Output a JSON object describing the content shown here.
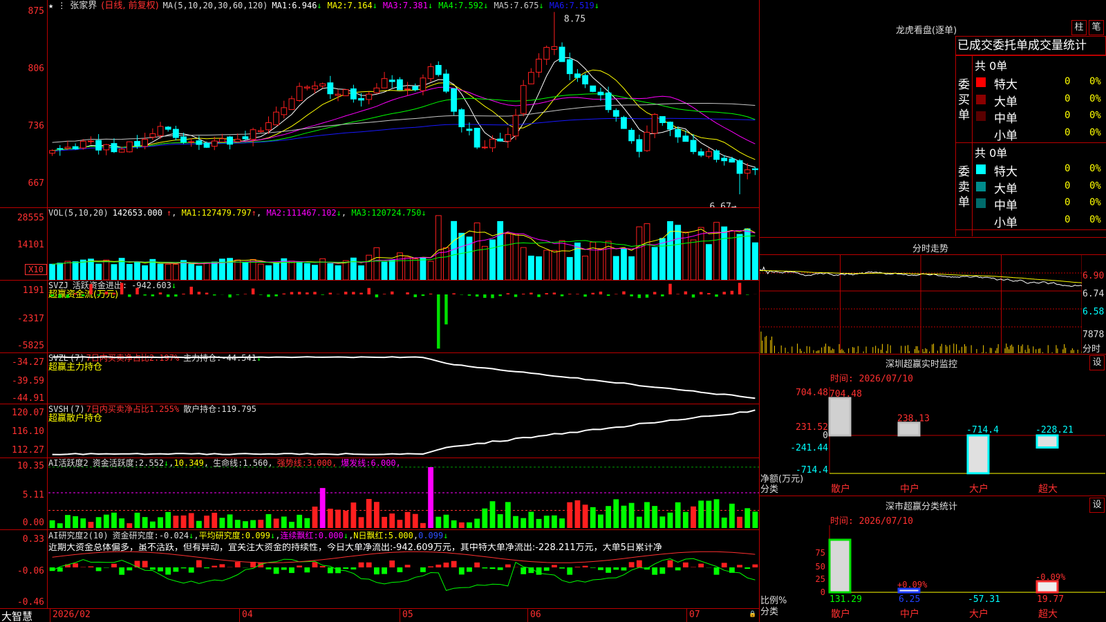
{
  "colors": {
    "up": "#ff1f1f",
    "down": "#00ffff",
    "bg": "#000000",
    "grid": "#bb0000",
    "axis": "#ff3030",
    "ma1": "#ffffff",
    "ma2": "#ffff00",
    "ma3": "#ff00ff",
    "ma4": "#00ff00",
    "ma5": "#c8c8c8",
    "ma6": "#1818ff"
  },
  "price": {
    "stock_name": "张家界",
    "period_label": "(日线, 前复权)",
    "ma_params": "MA(5,10,20,30,60,120)",
    "ma_values": [
      {
        "label": "MA1:",
        "value": "6.946",
        "arrow": "↓",
        "color": "#ffffff"
      },
      {
        "label": "MA2:",
        "value": "7.164",
        "arrow": "↓",
        "color": "#ffff00"
      },
      {
        "label": "MA3:",
        "value": "7.381",
        "arrow": "↓",
        "color": "#ff00ff"
      },
      {
        "label": "MA4:",
        "value": "7.592",
        "arrow": "↓",
        "color": "#00ff00"
      },
      {
        "label": "MA5:",
        "value": "7.675",
        "arrow": "↓",
        "color": "#c8c8c8"
      },
      {
        "label": "MA6:",
        "value": "7.519",
        "arrow": "↓",
        "color": "#1818ff"
      }
    ],
    "y_ticks": [
      "875",
      "806",
      "736",
      "667"
    ],
    "high_label": "8.75",
    "low_label": "6.67",
    "chart_data": {
      "type": "candlestick",
      "bars": 92,
      "ylim": [
        6.6,
        8.8
      ],
      "high": 8.75,
      "low": 6.67,
      "last_close": 6.95,
      "keypoints": [
        [
          0,
          7.2
        ],
        [
          5,
          7.25
        ],
        [
          10,
          7.2
        ],
        [
          14,
          7.25
        ],
        [
          18,
          7.45
        ],
        [
          22,
          7.25
        ],
        [
          27,
          7.25
        ],
        [
          32,
          7.35
        ],
        [
          38,
          7.6
        ],
        [
          42,
          7.95
        ],
        [
          47,
          7.85
        ],
        [
          52,
          7.75
        ],
        [
          55,
          7.95
        ],
        [
          60,
          7.85
        ],
        [
          63,
          8.2
        ],
        [
          66,
          7.65
        ],
        [
          70,
          7.25
        ],
        [
          75,
          7.3
        ],
        [
          79,
          8.1
        ],
        [
          82,
          8.45
        ],
        [
          86,
          8.0
        ],
        [
          90,
          7.85
        ],
        [
          93,
          7.55
        ],
        [
          97,
          7.2
        ],
        [
          100,
          7.6
        ],
        [
          105,
          7.2
        ],
        [
          110,
          7.05
        ],
        [
          116,
          6.9
        ]
      ],
      "seed": 11
    }
  },
  "vol": {
    "params": "VOL(5,10,20)",
    "value": "142653.000",
    "arrow": "↑",
    "mas": [
      {
        "label": "MA1:",
        "value": "127479.797",
        "arrow": "↑",
        "color": "#ffff00"
      },
      {
        "label": "MA2:",
        "value": "111467.102",
        "arrow": "↓",
        "color": "#ff00ff"
      },
      {
        "label": "MA3:",
        "value": "120724.750",
        "arrow": "↓",
        "color": "#00ff00"
      }
    ],
    "y_ticks": [
      "28555",
      "14101"
    ],
    "unit": "X10",
    "chart_data": {
      "type": "bar",
      "bars": 92,
      "ylim": [
        0,
        29000
      ],
      "seed": 23
    }
  },
  "svzj": {
    "name": "SVZJ",
    "label": "活跃资金进出:",
    "value": "-942.603",
    "arrow": "↓",
    "sub": "超赢资金流(万元)",
    "y_ticks": [
      "1191",
      "-2317",
      "-5825"
    ],
    "chart_data": {
      "type": "bar",
      "bars": 92,
      "ylim": [
        -6000,
        1500
      ],
      "seed": 31
    }
  },
  "svzl": {
    "name": "SVZL",
    "param": "(7)",
    "ratio": "7日内买卖净占比2.197%",
    "label": "主力持仓:",
    "value": "-44.541",
    "arrow": "↓",
    "sub": "超赢主力持仓",
    "y_ticks": [
      "-34.27",
      "-39.59",
      "-44.91"
    ],
    "chart_data": {
      "type": "line",
      "bars": 92,
      "ylim": [
        -46,
        -33
      ],
      "start": -34.2,
      "end": -44.6
    }
  },
  "svsh": {
    "name": "SVSH",
    "param": "(7)",
    "ratio": "7日内买卖净占比1.255%",
    "label": "散户持仓:",
    "value": "119.795",
    "sub": "超赢散户持仓",
    "y_ticks": [
      "120.07",
      "116.10",
      "112.27"
    ],
    "chart_data": {
      "type": "line",
      "bars": 92,
      "ylim": [
        111.8,
        121
      ],
      "start": 112.4,
      "end": 119.8
    }
  },
  "aihy": {
    "name": "AI活跃度2",
    "l1": "资金活跃度:",
    "v1": "2.552",
    "a1": "↓",
    "v2": "10.349",
    "l3": "生命线:",
    "v3": "1.560",
    "l4": "强势线:",
    "v4": "3.000",
    "l5": "爆发线:",
    "v5": "6.000",
    "y_ticks": [
      "10.35",
      "5.11",
      "0.00"
    ],
    "chart_data": {
      "type": "bar",
      "bars": 92,
      "ylim": [
        0,
        11
      ],
      "seed": 47
    }
  },
  "aiyj": {
    "name": "AI研究度2(10)",
    "l1": "资金研究度:",
    "v1": "-0.024",
    "a1": "↓",
    "l2": "平均研究度:",
    "v2": "0.099",
    "a2": "↓",
    "l3": "连续飘红:",
    "v3": "0.000",
    "a3": "↓",
    "l4": "N日飘红:",
    "v4": "5.000",
    "v5": "0.099",
    "a5": "↓",
    "comment": "近期大资金总体偏多，虽不活跃，但有异动，宜关注大资金的持续性，今日大单净流出:-942.609万元，其中特大单净流出:-228.211万元，大单5日累计净",
    "y_ticks": [
      "0.33",
      "-0.06",
      "-0.46"
    ],
    "chart_data": {
      "type": "bar",
      "bars": 92,
      "ylim": [
        -0.5,
        0.35
      ],
      "seed": 59
    }
  },
  "xaxis": {
    "brand": "大智慧",
    "labels": [
      "2026/02",
      "04",
      "05",
      "06",
      "07"
    ]
  },
  "lhb": {
    "title": "龙虎看盘(逐单)",
    "btn1": "柱",
    "btn2": "笔",
    "tabs": [
      "已成交",
      "委托单",
      "成交量统计"
    ],
    "buy": {
      "group": "委买单",
      "total": "共 0单",
      "rows": [
        {
          "label": "特大",
          "color": "#ff0000",
          "v": "0",
          "p": "0%"
        },
        {
          "label": "大单",
          "color": "#8b0000",
          "v": "0",
          "p": "0%"
        },
        {
          "label": "中单",
          "color": "#5a0000",
          "v": "0",
          "p": "0%"
        },
        {
          "label": "小单",
          "color": "",
          "v": "0",
          "p": "0%"
        }
      ]
    },
    "sell": {
      "group": "委卖单",
      "total": "共 0单",
      "rows": [
        {
          "label": "特大",
          "color": "#00ffff",
          "v": "0",
          "p": "0%"
        },
        {
          "label": "大单",
          "color": "#008b8b",
          "v": "0",
          "p": "0%"
        },
        {
          "label": "中单",
          "color": "#006b6b",
          "v": "0",
          "p": "0%"
        },
        {
          "label": "小单",
          "color": "",
          "v": "0",
          "p": "0%"
        }
      ]
    }
  },
  "fenshi": {
    "title": "分时走势",
    "y_ticks": [
      "6.90",
      "6.74",
      "6.58"
    ],
    "vol_tick": "7878",
    "vol_label": "分时",
    "chart_data": {
      "type": "line",
      "points": 240,
      "ylim": [
        6.5,
        7.05
      ],
      "seed": 71
    }
  },
  "sz_monitor": {
    "title": "深圳超赢实时监控",
    "btn": "设",
    "time": "时间: 2026/07/10",
    "y_ticks": [
      "704.48",
      "231.52",
      "0",
      "-241.44",
      "-714.4"
    ],
    "ylabel": "净额(万元)",
    "xlabel": "分类",
    "chart_data": {
      "type": "bar",
      "categories": [
        "散户",
        "中户",
        "大户",
        "超大"
      ],
      "values": [
        704.48,
        238.13,
        -714.4,
        -228.21
      ],
      "labels": [
        "704.48",
        "238.13",
        "-714.4",
        "-228.21"
      ],
      "ylim": [
        -714.4,
        704.48
      ]
    }
  },
  "sz_class": {
    "title": "深市超赢分类统计",
    "btn": "设",
    "time": "时间: 2026/07/10",
    "y_ticks": [
      "75",
      "50",
      "25",
      "0"
    ],
    "ylabel": "比例%",
    "xlabel": "分类",
    "chart_data": {
      "type": "bar",
      "categories": [
        "散户",
        "中户",
        "大户",
        "超大"
      ],
      "values": [
        131.29,
        6.25,
        -57.31,
        19.77
      ],
      "value_labels": [
        "131.29",
        "6.25",
        "-57.31",
        "19.77"
      ],
      "pct_labels": [
        "",
        "+0.09%",
        "",
        "-0.09%"
      ],
      "ylim": [
        0,
        90
      ]
    }
  }
}
